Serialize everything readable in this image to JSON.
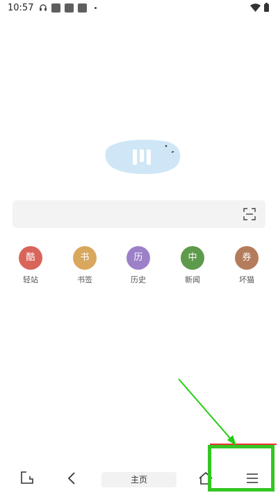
{
  "status_bar": {
    "time": "10:57",
    "icons": [
      "headset-icon",
      "notification-icon",
      "notification-icon",
      "notification-icon",
      "dot-icon",
      "wifi-icon",
      "battery-icon"
    ]
  },
  "logo": {
    "icon": "browser-logo-icon",
    "color": "#cfe6f6"
  },
  "search": {
    "placeholder": "",
    "scan_icon": "scan-icon"
  },
  "shortcuts": [
    {
      "glyph": "酷",
      "label": "轻站",
      "color": "#d9645a"
    },
    {
      "glyph": "书",
      "label": "书签",
      "color": "#d9a85e"
    },
    {
      "glyph": "历",
      "label": "历史",
      "color": "#9c81c9"
    },
    {
      "glyph": "中",
      "label": "新闻",
      "color": "#5e9a4c"
    },
    {
      "glyph": "券",
      "label": "坏猫",
      "color": "#b47c5c"
    }
  ],
  "bottom_nav": {
    "tabs_icon": "tabs-icon",
    "back_icon": "back-icon",
    "home_label": "主页",
    "home_icon": "home-icon",
    "menu_icon": "menu-icon"
  },
  "annotation": {
    "highlight_color": "#34c624",
    "arrow_color": "#22cc11"
  }
}
